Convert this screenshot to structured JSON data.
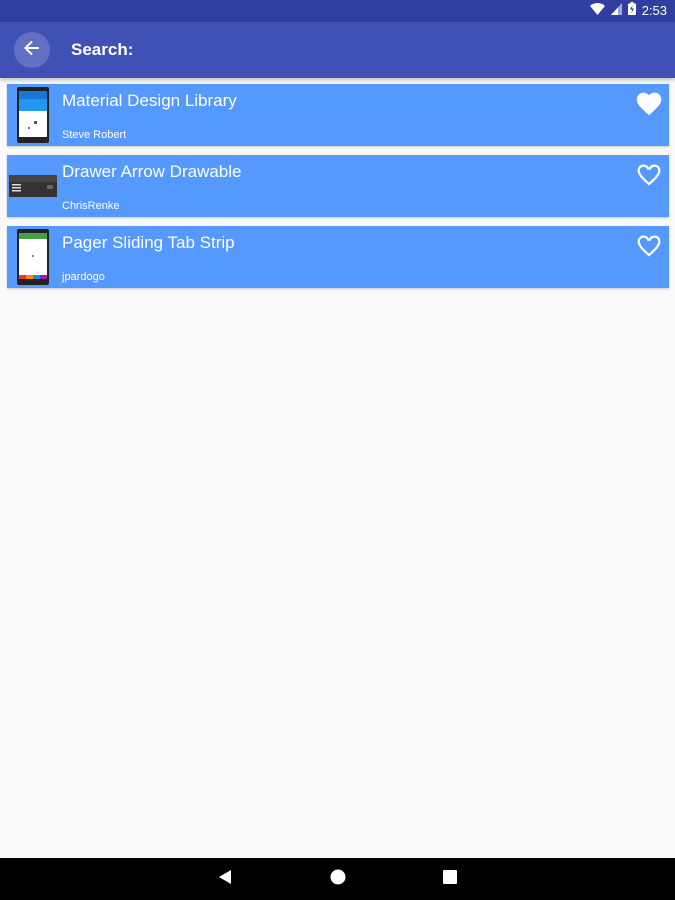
{
  "status_bar": {
    "time": "2:53",
    "icons": [
      "wifi-icon",
      "signal-icon",
      "battery-icon"
    ]
  },
  "app_bar": {
    "title": "Search:",
    "back_icon": "arrow-back-icon"
  },
  "results": [
    {
      "title": "Material Design Library",
      "author": "Steve Robert",
      "favorited": true,
      "thumbnail": "phone-screenshot"
    },
    {
      "title": "Drawer Arrow Drawable",
      "author": "ChrisRenke",
      "favorited": false,
      "thumbnail": "toolbar-screenshot"
    },
    {
      "title": "Pager Sliding Tab Strip",
      "author": "jpardogo",
      "favorited": false,
      "thumbnail": "phone-tabs-screenshot"
    }
  ],
  "nav_bar": {
    "icons": [
      "back-triangle-icon",
      "home-circle-icon",
      "recents-square-icon"
    ]
  },
  "colors": {
    "status_bar": "#303f9f",
    "app_bar": "#3f51b5",
    "item_background": "#5599ff",
    "background": "#fafafa"
  }
}
